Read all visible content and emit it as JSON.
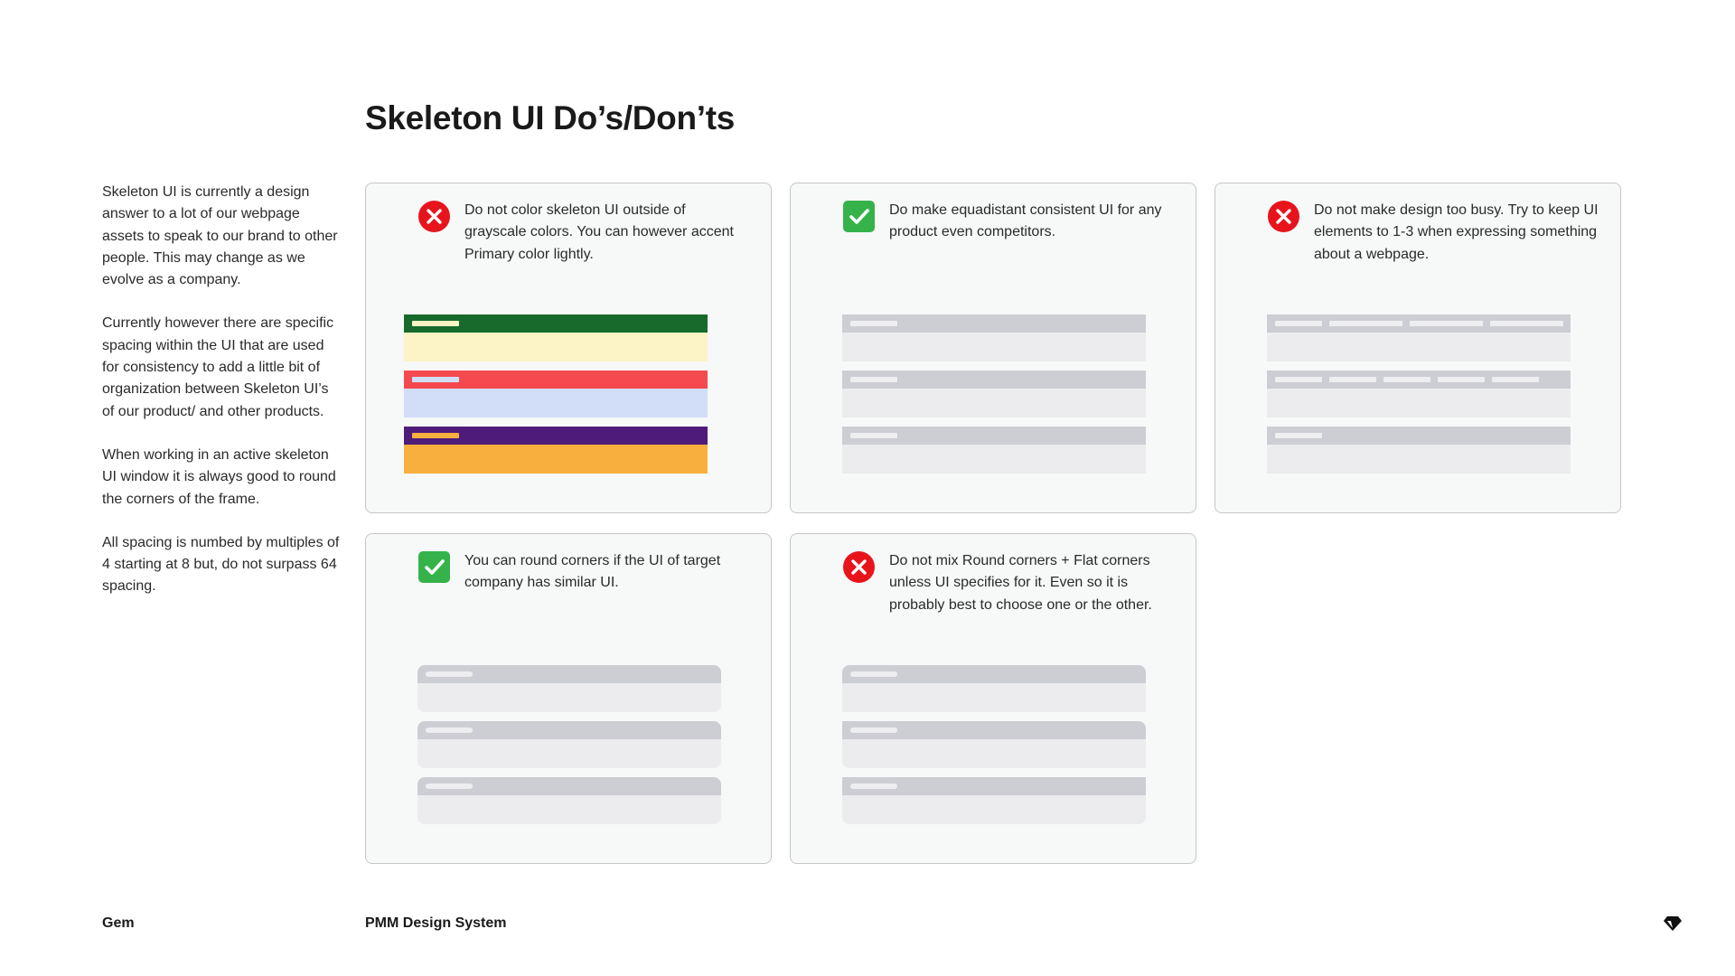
{
  "page": {
    "title": "Skeleton UI Do’s/Don’ts"
  },
  "sidebar": {
    "paragraphs": [
      "Skeleton UI is currently a design answer to a lot of our webpage assets to speak to our brand to other people. This may change as we evolve as a company.",
      "Currently however there are specific spacing within the UI that are used for consistency to add a little bit of organization between Skeleton UI’s of our product/ and other products.",
      "When working in an active skeleton UI window it is always good to round the corners of the frame.",
      "All spacing is numbed by multiples of 4 starting at 8 but, do not surpass 64 spacing."
    ]
  },
  "cards": [
    {
      "kind": "dont",
      "icon": "x-circle-icon",
      "text": "Do not color skeleton UI outside of grayscale colors. You can however accent Primary color lightly."
    },
    {
      "kind": "do",
      "icon": "check-square-icon",
      "text": "Do make equadistant consistent UI for any product even competitors."
    },
    {
      "kind": "dont",
      "icon": "x-circle-icon",
      "text": "Do not make design too busy. Try to keep UI elements to 1-3 when expressing something about a webpage."
    },
    {
      "kind": "do",
      "icon": "check-square-icon",
      "text": "You can round corners if the UI of target company has similar UI."
    },
    {
      "kind": "dont",
      "icon": "x-circle-icon",
      "text": "Do not mix Round corners + Flat corners unless UI specifies for it. Even so it is probably best to choose one or the other."
    }
  ],
  "colors": {
    "do": "#35b34a",
    "dont": "#e8141c",
    "colored_rows": [
      {
        "bar": "#176a2c",
        "body": "#fcf3c6",
        "pill": "#fcf3c6"
      },
      {
        "bar": "#f44a4f",
        "body": "#d2def8",
        "pill": "#d2def8"
      },
      {
        "bar": "#4e1b7a",
        "body": "#f9af3d",
        "pill": "#f9af3d"
      }
    ]
  },
  "footer": {
    "brand": "Gem",
    "title": "PMM Design System",
    "logo": "gem-logo-icon"
  }
}
